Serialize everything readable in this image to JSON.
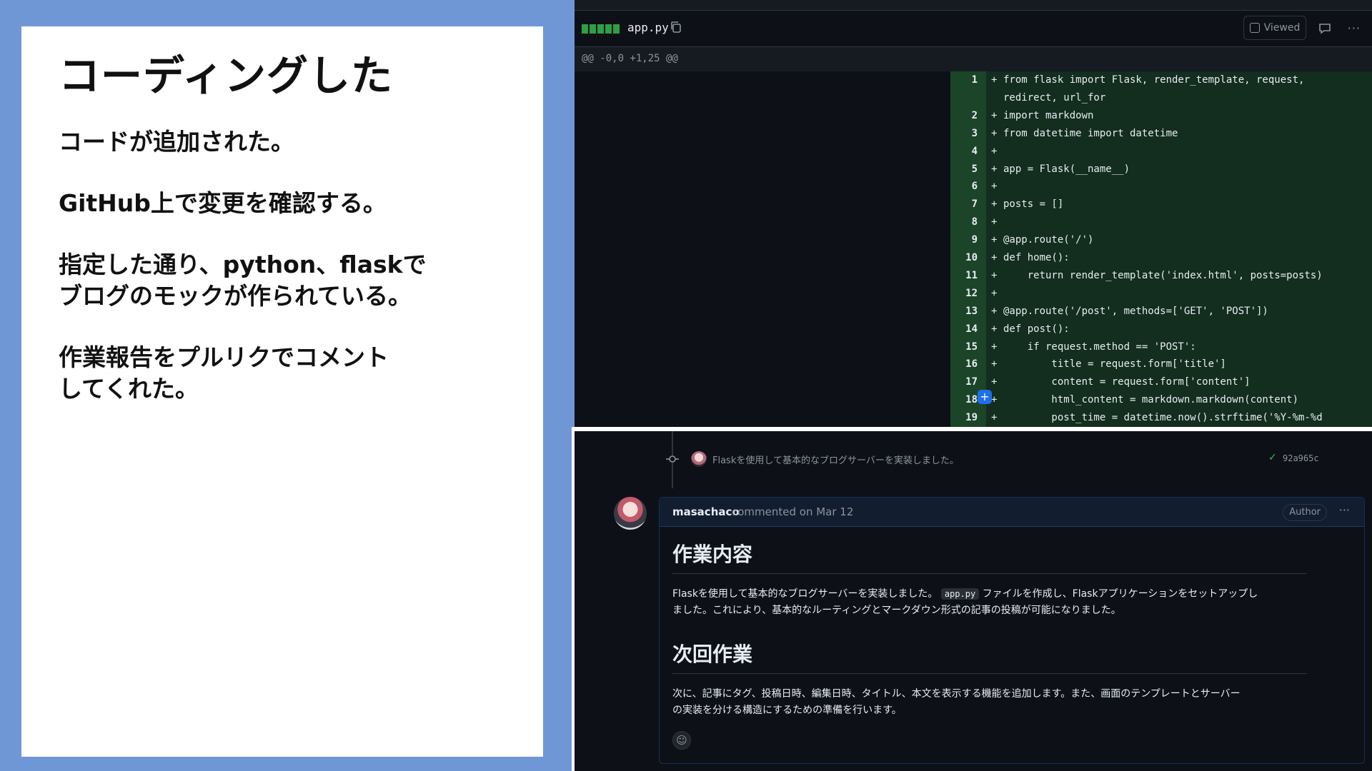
{
  "slide": {
    "title": "コーディングした",
    "paragraphs": [
      [
        "コードが追加された。"
      ],
      [
        "GitHub上で変更を確認する。"
      ],
      [
        "指定した通り、python、flaskで",
        "ブログのモックが作られている。"
      ],
      [
        "作業報告をプルリクでコメント",
        "してくれた。"
      ]
    ]
  },
  "diff": {
    "filename": "app.py",
    "viewed_label": "Viewed",
    "hunk_header": "@@ -0,0 +1,25 @@",
    "lines": [
      {
        "num": "1",
        "code": "from flask import Flask, render_template, request,"
      },
      {
        "num": "",
        "code": "redirect, url_for"
      },
      {
        "num": "2",
        "code": "import markdown"
      },
      {
        "num": "3",
        "code": "from datetime import datetime"
      },
      {
        "num": "4",
        "code": ""
      },
      {
        "num": "5",
        "code": "app = Flask(__name__)"
      },
      {
        "num": "6",
        "code": ""
      },
      {
        "num": "7",
        "code": "posts = []"
      },
      {
        "num": "8",
        "code": ""
      },
      {
        "num": "9",
        "code": "@app.route('/')"
      },
      {
        "num": "10",
        "code": "def home():"
      },
      {
        "num": "11",
        "code": "    return render_template('index.html', posts=posts)"
      },
      {
        "num": "12",
        "code": ""
      },
      {
        "num": "13",
        "code": "@app.route('/post', methods=['GET', 'POST'])"
      },
      {
        "num": "14",
        "code": "def post():"
      },
      {
        "num": "15",
        "code": "    if request.method == 'POST':"
      },
      {
        "num": "16",
        "code": "        title = request.form['title']"
      },
      {
        "num": "17",
        "code": "        content = request.form['content']"
      },
      {
        "num": "18",
        "code": "        html_content = markdown.markdown(content)"
      },
      {
        "num": "19",
        "code": "        post_time = datetime.now().strftime('%Y-%m-%d"
      }
    ]
  },
  "timeline": {
    "commit_message": "Flaskを使用して基本的なブログサーバーを実装しました。",
    "commit_sha": "92a965c",
    "comment": {
      "author": "masachaco",
      "meta": "commented on Mar 12",
      "badge": "Author",
      "section1_heading": "作業内容",
      "section1_before_code": "Flaskを使用して基本的なブログサーバーを実装しました。",
      "section1_code": "app.py",
      "section1_after_code": "ファイルを作成し、Flaskアプリケーションをセットアップし",
      "section1_line2": "ました。これにより、基本的なルーティングとマークダウン形式の記事の投稿が可能になりました。",
      "section2_heading": "次回作業",
      "section2_line1": "次に、記事にタグ、投稿日時、編集日時、タイトル、本文を表示する機能を追加します。また、画面のテンプレートとサーバー",
      "section2_line2": "の実装を分ける構造にするための準備を行います。"
    }
  }
}
